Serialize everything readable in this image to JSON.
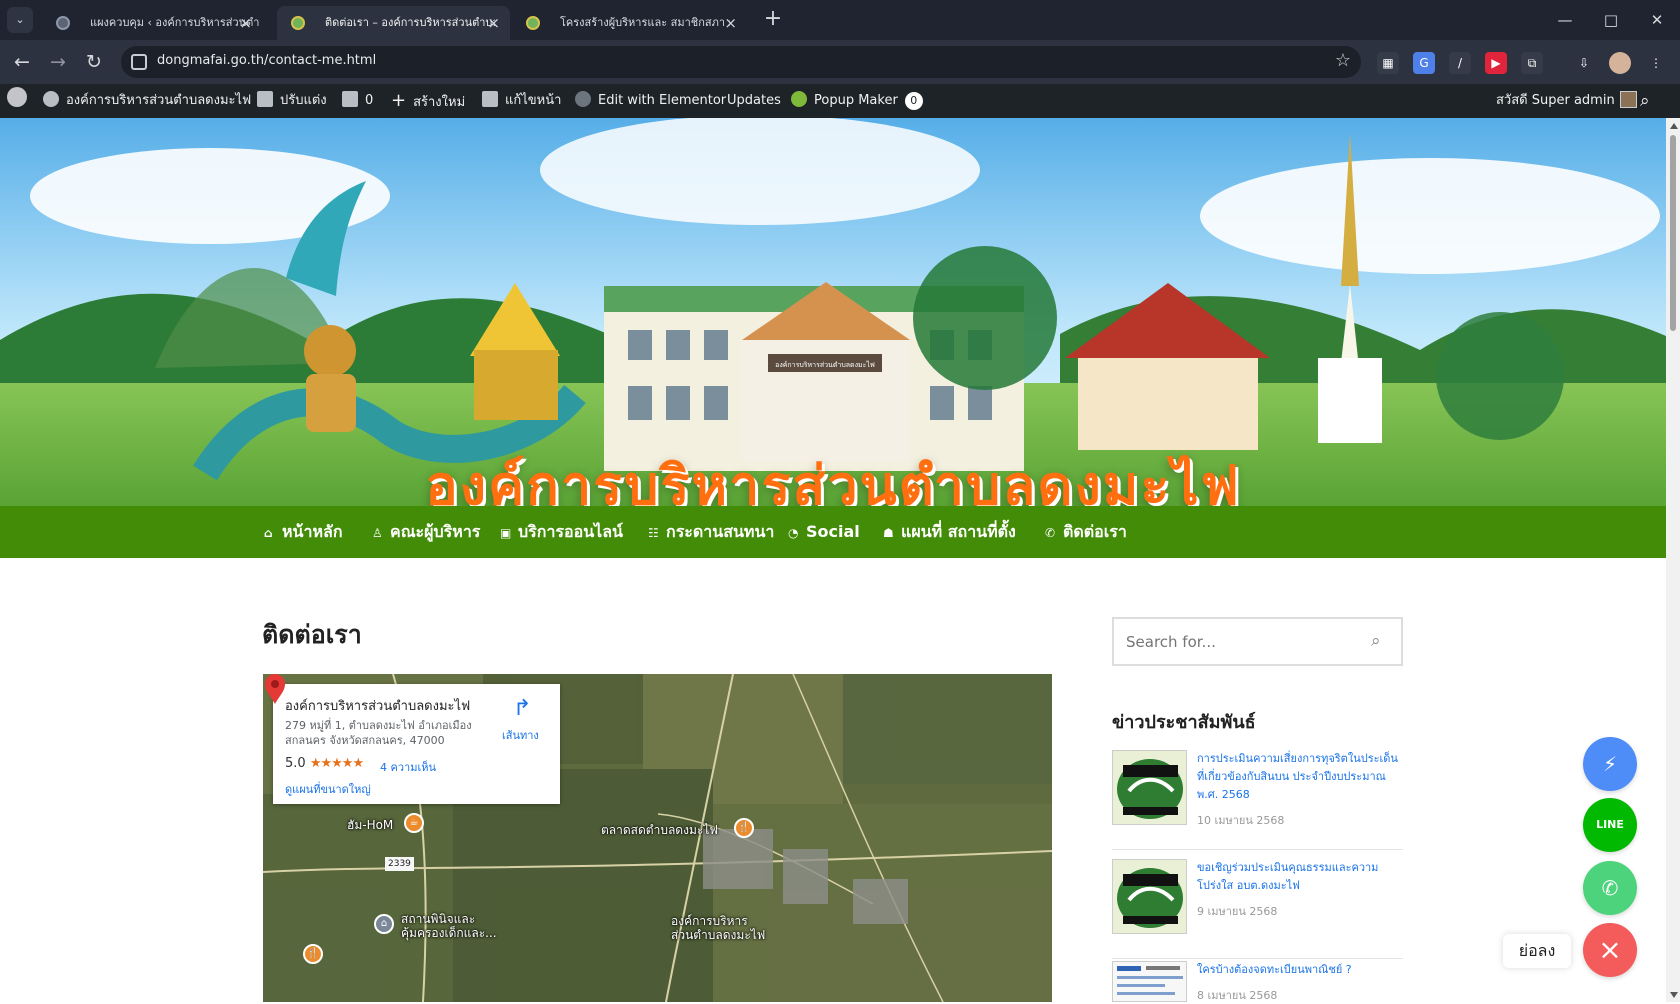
{
  "browser": {
    "tabs": [
      {
        "title": "แผงควบคุม ‹ องค์การบริหารส่วนตำบล",
        "active": false
      },
      {
        "title": "ติดต่อเรา – องค์การบริหารส่วนตำบล",
        "active": true
      },
      {
        "title": "โครงสร้างผู้บริหารและ สมาชิกสภา อบ",
        "active": false
      }
    ],
    "url": "dongmafai.go.th/contact-me.html",
    "new_tab_label": "+",
    "minimize": "—",
    "maximize": "□",
    "close": "✕"
  },
  "admin_bar": {
    "site_name": "องค์การบริหารส่วนตำบลดงมะไฟ",
    "customize": "ปรับแต่ง",
    "comments": "0",
    "new": "สร้างใหม่",
    "edit_page": "แก้ไขหน้า",
    "elementor": "Edit with Elementor",
    "updates": "Updates",
    "popup_maker": "Popup Maker",
    "popup_count": "0",
    "greeting": "สวัสดี Super admin"
  },
  "hero": {
    "title": "องค์การบริหารส่วนตำบลดงมะไฟ",
    "building_sign": "องค์การบริหารส่วนตำบลดงมะไฟ"
  },
  "main_nav": [
    {
      "label": "หน้าหลัก",
      "icon": "home-icon",
      "glyph": "⌂"
    },
    {
      "label": "คณะผู้บริหาร",
      "icon": "person-icon",
      "glyph": "♙"
    },
    {
      "label": "บริการออนไลน์",
      "icon": "inbox-icon",
      "glyph": "▣"
    },
    {
      "label": "กระดานสนทนา",
      "icon": "chat-icon",
      "glyph": "☷"
    },
    {
      "label": "Social",
      "icon": "rss-icon",
      "glyph": "◔"
    },
    {
      "label": "แผนที่ สถานที่ตั้ง",
      "icon": "map-icon",
      "glyph": "☗"
    },
    {
      "label": "ติดต่อเรา",
      "icon": "phone-icon",
      "glyph": "✆"
    }
  ],
  "page": {
    "title": "ติดต่อเรา"
  },
  "map_card": {
    "title": "องค์การบริหารส่วนตำบลดงมะไฟ",
    "address": "279 หมู่ที่ 1, ตำบลดงมะไฟ อำเภอเมือง สกลนคร จังหวัดสกลนคร, 47000",
    "rating": "5.0",
    "stars": "★★★★★",
    "reviews": "4 ความเห็น",
    "directions": "เส้นทาง",
    "larger_map": "ดูแผนที่ขนาดใหญ่"
  },
  "map_labels": {
    "home": "ฮัม-HoM",
    "market": "ตลาดสดตำบลดงมะไฟ",
    "road": "2339",
    "childcare": "สถานพินิจและ\nคุ้มครองเด็กและ...",
    "office": "องค์การบริหาร\nส่วนตำบลดงมะไฟ"
  },
  "sidebar": {
    "search_placeholder": "Search for...",
    "news_heading": "ข่าวประชาสัมพันธ์",
    "news": [
      {
        "title": "การประเมินความเสี่ยงการทุจริตในประเด็นที่เกี่ยวข้องกับสินบน ประจำปีงบประมาณ พ.ศ. 2568",
        "date": "10 เมษายน 2568"
      },
      {
        "title": "ขอเชิญร่วมประเมินคุณธรรมและความโปร่งใส อบต.ดงมะไฟ",
        "date": "9 เมษายน 2568"
      },
      {
        "title": "ใครบ้างต้องจดทะเบียนพาณิชย์ ?",
        "date": "8 เมษายน 2568"
      }
    ]
  },
  "floating": {
    "collapse": "ย่อลง",
    "line": "LINE"
  },
  "colors": {
    "nav_green": "#438c08",
    "title_orange": "#ff6f10",
    "messenger": "#4e8cf7",
    "line": "#00b900",
    "phone": "#4cd37c",
    "close": "#f45b5b"
  }
}
